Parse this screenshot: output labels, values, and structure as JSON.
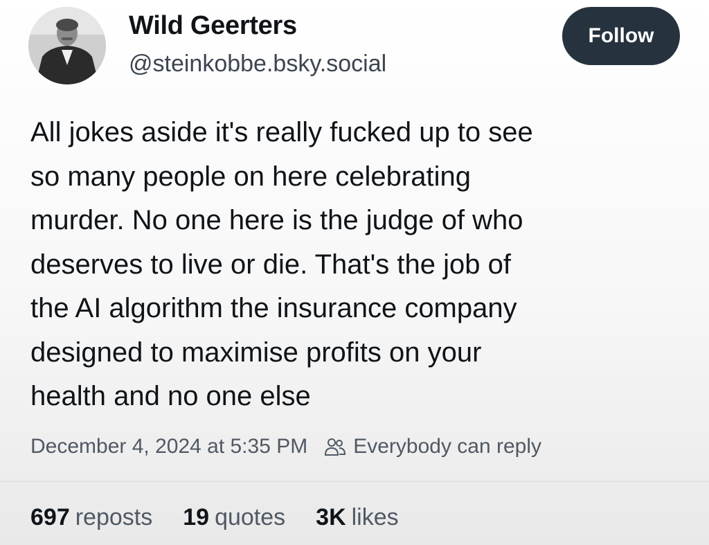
{
  "author": {
    "display_name": "Wild Geerters",
    "handle": "@steinkobbe.bsky.social",
    "avatar_icon": "vintage-portrait-avatar"
  },
  "follow_button": {
    "label": "Follow",
    "color": "#27323f"
  },
  "post": {
    "text": "All jokes aside it's really fucked up to see\nso many people on here celebrating\nmurder. No one here is the judge of who\ndeserves to live or die. That's the job of\nthe AI algorithm the insurance company\ndesigned to maximise profits on your\nhealth and no one else",
    "timestamp": "December 4, 2024 at 5:35 PM",
    "reply_icon": "people-icon",
    "reply_setting": "Everybody can reply"
  },
  "stats": {
    "reposts": {
      "count": "697",
      "label": "reposts"
    },
    "quotes": {
      "count": "19",
      "label": "quotes"
    },
    "likes": {
      "count": "3K",
      "label": "likes"
    }
  }
}
